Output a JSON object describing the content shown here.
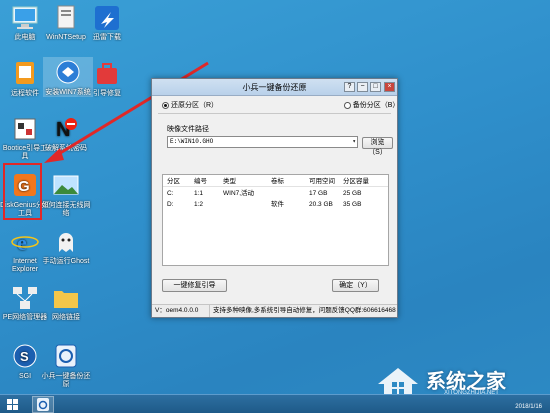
{
  "desktop": {
    "icons": [
      {
        "label": "此电脑"
      },
      {
        "label": "WinNTSetup"
      },
      {
        "label": "迅雷下载"
      },
      {
        "label": "远程软件"
      },
      {
        "label": "安装WIN7系统"
      },
      {
        "label": "引导修复"
      },
      {
        "label": "Bootice引导工具"
      },
      {
        "label": "破解系统密码"
      },
      {
        "label": "DiskGenius分区工具"
      },
      {
        "label": "如何连接无线网络"
      },
      {
        "label": "Internet Explorer"
      },
      {
        "label": "手动运行Ghost"
      },
      {
        "label": "PE网络管理器"
      },
      {
        "label": "网络链接"
      },
      {
        "label": "SGI"
      },
      {
        "label": "小兵一键备份还原"
      }
    ]
  },
  "window": {
    "title": "小兵一键备份还原",
    "restore_label": "还原分区（R）",
    "backup_label": "备份分区（B）",
    "restore_selected": true,
    "path_label": "映像文件路径",
    "path_value": "E:\\WIN10.GHO",
    "browse_label": "浏览（S）",
    "table": {
      "headers": [
        "分区",
        "编号",
        "类型",
        "卷标",
        "可用空间",
        "分区容量"
      ],
      "rows": [
        [
          "C:",
          "1:1",
          "WIN7,活动",
          "",
          "17 GB",
          "25 GB"
        ],
        [
          "D:",
          "1:2",
          "",
          "软件",
          "20.3 GB",
          "35 GB"
        ]
      ]
    },
    "repair_label": "一键修复引导",
    "ok_label": "确定（Y）",
    "status_version": "V：oem4.0.0.0",
    "status_text": "支持多种映像,多系统引导自动修复，问题反馈QQ群:606616468"
  },
  "watermark": {
    "title": "系统之家",
    "url": "XITONGZHIJIA.NET"
  },
  "taskbar": {
    "date": "2018/1/16"
  },
  "colors": {
    "desktop": "#2f8fcb",
    "highlight": "#e02828",
    "arrow": "#e02828"
  }
}
